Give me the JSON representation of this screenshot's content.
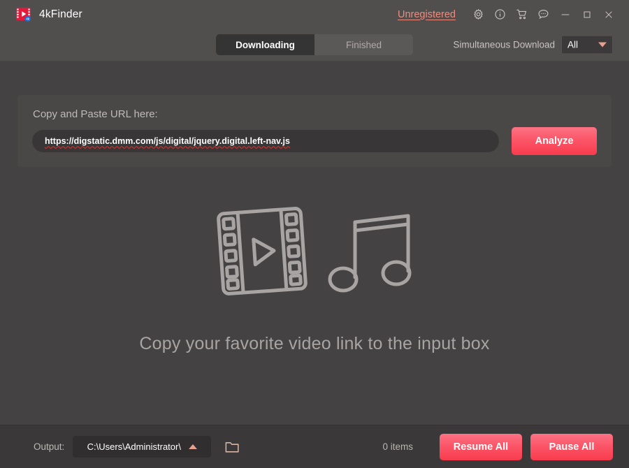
{
  "window": {
    "app_name": "4kFinder",
    "logo_icon": "film-play-logo-icon"
  },
  "titlebar": {
    "license_status": "Unregistered",
    "icons": [
      {
        "name": "gear-icon",
        "label": "Settings"
      },
      {
        "name": "info-icon",
        "label": "Information"
      },
      {
        "name": "cart-icon",
        "label": "Store"
      },
      {
        "name": "chat-icon",
        "label": "Feedback"
      }
    ],
    "window_controls": [
      {
        "name": "minimize-icon",
        "label": "Minimize"
      },
      {
        "name": "maximize-icon",
        "label": "Maximize"
      },
      {
        "name": "close-icon",
        "label": "Close"
      }
    ]
  },
  "tabs": [
    {
      "label": "Downloading",
      "active": true
    },
    {
      "label": "Finished",
      "active": false
    }
  ],
  "simultaneous": {
    "label": "Simultaneous Download",
    "value": "All",
    "chevron_icon": "chevron-down-icon"
  },
  "url_panel": {
    "label": "Copy and Paste URL here:",
    "url_value": "https://digstatic.dmm.com/js/digital/jquery.digital.left-nav.js",
    "url_placeholder": "Copy and Paste URL here:",
    "analyze_label": "Analyze"
  },
  "empty_state": {
    "message": "Copy your favorite video link to the input box",
    "illustration_icons": [
      "film-strip-icon",
      "music-note-icon"
    ]
  },
  "bottombar": {
    "output_label": "Output:",
    "output_path": "C:\\Users\\Administrator\\",
    "output_chevron_icon": "chevron-up-icon",
    "folder_icon": "folder-open-icon",
    "items_count": "0 items",
    "resume_all_label": "Resume All",
    "pause_all_label": "Pause All"
  },
  "colors": {
    "titlebar_bg": "#514E4E",
    "body_bg": "#444242",
    "panel_bg": "#4A4747",
    "input_bg": "#383636",
    "bottombar_bg": "#3A3838",
    "accent_red": "#FB5668",
    "accent_salmon": "#EE8C7E",
    "active_tab_bg": "#353434",
    "inactive_tab_bg": "#5B5858",
    "muted_text": "#A9A4A4"
  }
}
